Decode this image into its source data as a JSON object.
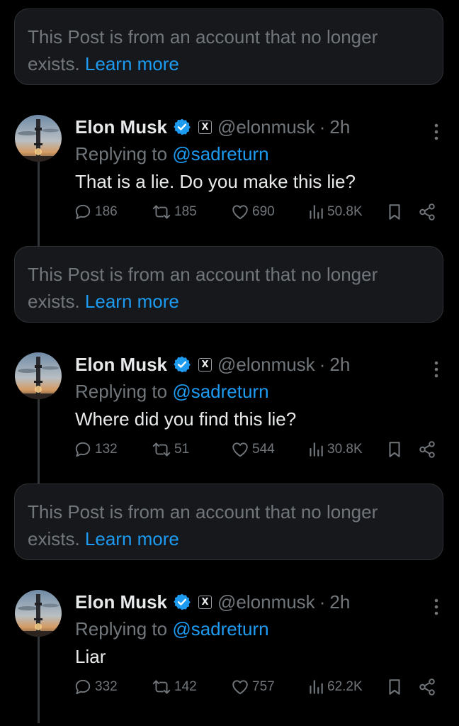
{
  "notice": {
    "text": "This Post is from an account that no longer exists.",
    "line1": "This Post is from an account that no longer",
    "line2": "exists.",
    "link": "Learn more"
  },
  "colors": {
    "background": "#000000",
    "card": "#16181c",
    "text": "#e7e9ea",
    "muted": "#71767b",
    "accent": "#1d9bf0"
  },
  "tweets": [
    {
      "name": "Elon Musk",
      "badge": "verified-badge-icon",
      "affiliate": "X",
      "handle": "@elonmusk",
      "separator": "·",
      "time": "2h",
      "replying_prefix": "Replying to",
      "replying_to": "@sadreturn",
      "text": "That is a lie. Do you make this lie?",
      "replies": "186",
      "reposts": "185",
      "likes": "690",
      "views": "50.8K"
    },
    {
      "name": "Elon Musk",
      "badge": "verified-badge-icon",
      "affiliate": "X",
      "handle": "@elonmusk",
      "separator": "·",
      "time": "2h",
      "replying_prefix": "Replying to",
      "replying_to": "@sadreturn",
      "text": "Where did you find this lie?",
      "replies": "132",
      "reposts": "51",
      "likes": "544",
      "views": "30.8K"
    },
    {
      "name": "Elon Musk",
      "badge": "verified-badge-icon",
      "affiliate": "X",
      "handle": "@elonmusk",
      "separator": "·",
      "time": "2h",
      "replying_prefix": "Replying to",
      "replying_to": "@sadreturn",
      "text": "Liar",
      "replies": "332",
      "reposts": "142",
      "likes": "757",
      "views": "62.2K"
    }
  ]
}
